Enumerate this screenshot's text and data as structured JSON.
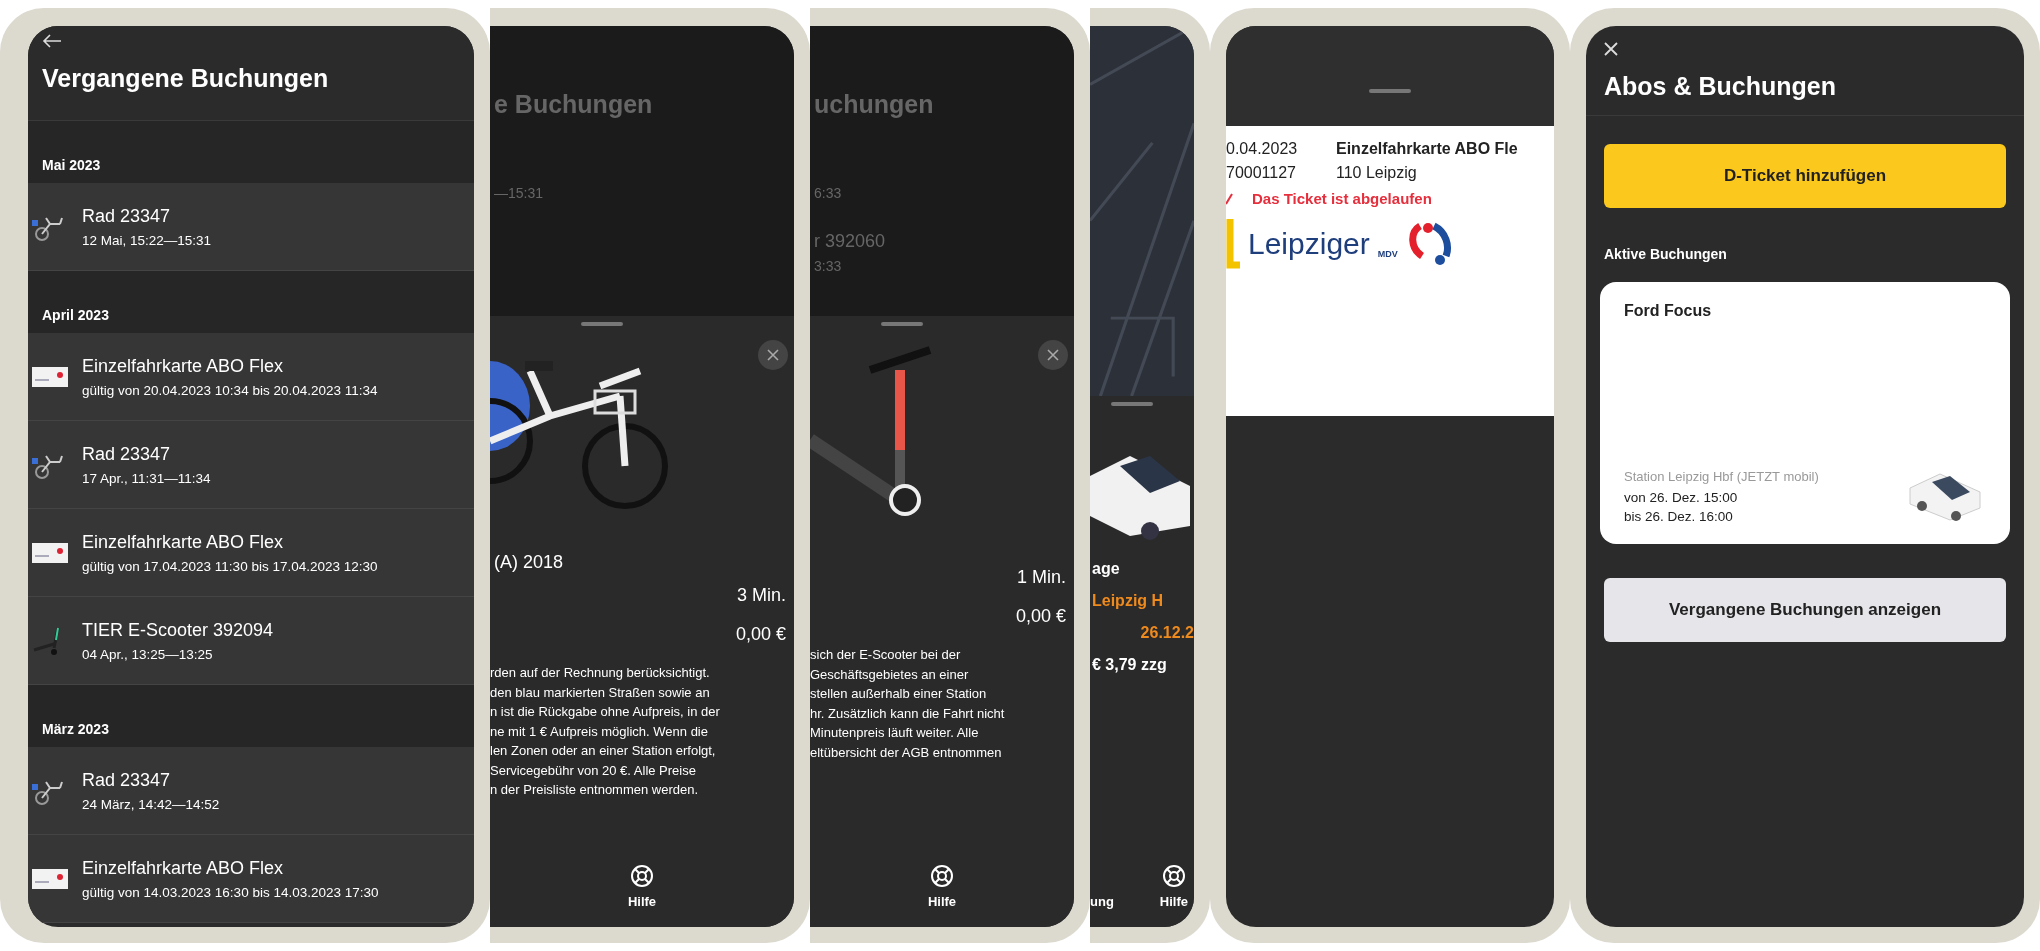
{
  "history_screen": {
    "title": "Vergangene Buchungen",
    "sections": [
      {
        "month": "Mai 2023",
        "items": [
          {
            "kind": "bike",
            "title": "Rad 23347",
            "subtitle": "12 Mai, 15:22—15:31"
          }
        ]
      },
      {
        "month": "April 2023",
        "items": [
          {
            "kind": "ticket",
            "title": "Einzelfahrkarte ABO Flex",
            "subtitle": "gültig von 20.04.2023 10:34 bis 20.04.2023 11:34"
          },
          {
            "kind": "bike",
            "title": "Rad 23347",
            "subtitle": "17 Apr., 11:31—11:34"
          },
          {
            "kind": "ticket",
            "title": "Einzelfahrkarte ABO Flex",
            "subtitle": "gültig von 17.04.2023 11:30 bis 17.04.2023 12:30"
          },
          {
            "kind": "scooter",
            "title": "TIER E-Scooter 392094",
            "subtitle": "04 Apr., 13:25—13:25"
          }
        ]
      },
      {
        "month": "März 2023",
        "items": [
          {
            "kind": "bike",
            "title": "Rad 23347",
            "subtitle": "24 März, 14:42—14:52"
          },
          {
            "kind": "ticket",
            "title": "Einzelfahrkarte ABO Flex",
            "subtitle": "gültig von 14.03.2023 16:30 bis 14.03.2023 17:30"
          }
        ]
      }
    ]
  },
  "bike_detail_screen": {
    "title_fragment": "e Buchungen",
    "row_fragments": [
      "—15:31"
    ],
    "model": "(A) 2018",
    "duration": "3 Min.",
    "price": "0,00 €",
    "description_lines": [
      "rden auf der Rechnung berücksichtigt.",
      "den blau markierten Straßen sowie an",
      "n ist die Rückgabe ohne Aufpreis, in der",
      "ne mit 1 € Aufpreis möglich. Wenn die",
      "len Zonen oder an einer Station erfolgt,",
      "Servicegebühr von 20 €. Alle Preise",
      "n der Preisliste entnommen werden."
    ],
    "nav": [
      {
        "label": "Hilfe"
      }
    ]
  },
  "scooter_detail_screen": {
    "title_fragment": "uchungen",
    "row_fragments": [
      "6:33",
      "r 392060",
      "3:33"
    ],
    "duration": "1 Min.",
    "price": "0,00 €",
    "description_lines": [
      "sich der E-Scooter bei der",
      "Geschäftsgebietes an einer",
      "stellen außerhalb einer Station",
      "hr. Zusätzlich kann die Fahrt nicht",
      "Minutenpreis läuft weiter. Alle",
      "eltübersicht der AGB entnommen"
    ],
    "nav": [
      {
        "label": "Hilfe"
      }
    ]
  },
  "car_detail_screen": {
    "label_fragment": "age",
    "station": "Leipzig H",
    "date": "26.12.2",
    "price": "€ 3,79 zzg",
    "nav": [
      {
        "label": "ung"
      },
      {
        "label": "Hilfe"
      }
    ]
  },
  "ticket_screen": {
    "date": "0.04.2023",
    "number": "70001127",
    "product": "Einzelfahrkarte ABO Fle",
    "zone": "110 Leipzig",
    "warning": "Das Ticket ist abgelaufen",
    "logo_text": "Leipziger",
    "logo_small": "MDV"
  },
  "bookings_screen": {
    "title": "Abos & Buchungen",
    "add_button": "D-Ticket hinzufügen",
    "section": "Aktive Buchungen",
    "booking": {
      "title": "Ford Focus",
      "station": "Station Leipzig Hbf (JETZT mobil)",
      "from": "von 26. Dez. 15:00",
      "to": "bis 26. Dez. 16:00"
    },
    "past_button": "Vergangene Buchungen anzeigen"
  }
}
